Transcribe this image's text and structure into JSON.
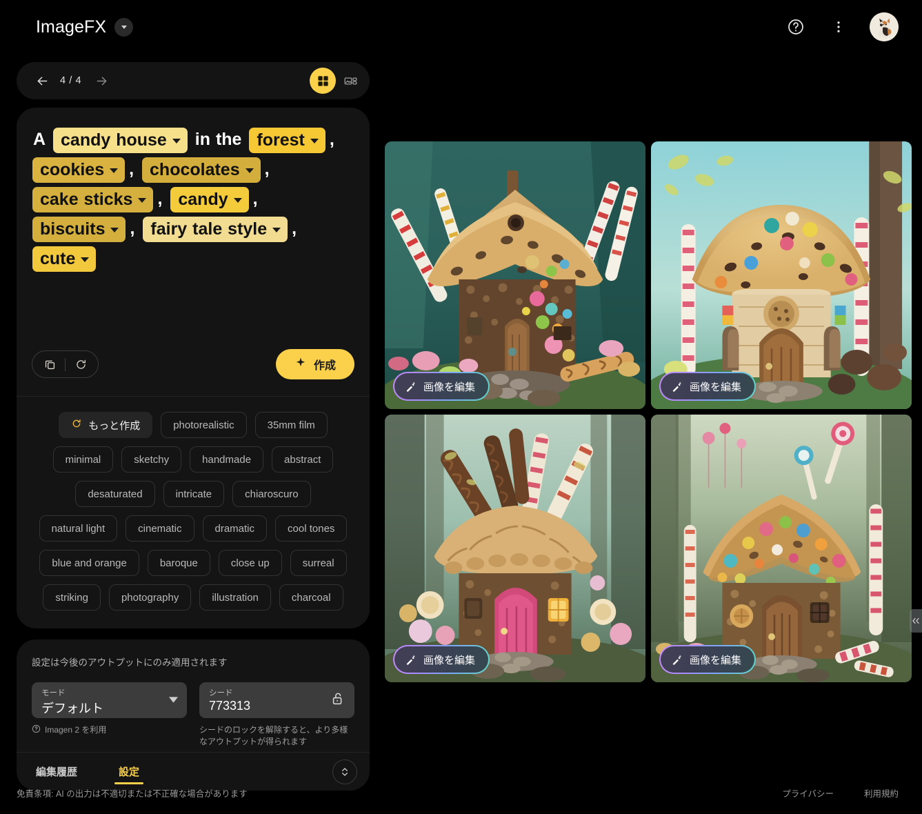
{
  "header": {
    "brand_title": "ImageFX",
    "brand_caret_icon": "chevron-down-icon",
    "help_icon": "help-circle-icon",
    "more_icon": "more-vertical-icon",
    "avatar_icon": "cat-avatar"
  },
  "nav": {
    "prev_icon": "arrow-left-icon",
    "next_icon": "arrow-right-icon",
    "page_indicator": "4 / 4",
    "grid_view_icon": "grid-view-icon",
    "detail_view_icon": "detail-view-icon"
  },
  "prompt": {
    "lead": "A",
    "connector": "in the",
    "chips": [
      {
        "label": "candy house",
        "shade": "#f6e08a"
      },
      {
        "label": "forest",
        "shade": "#f6c833"
      },
      {
        "label": "cookies",
        "shade": "#d9b23f"
      },
      {
        "label": "chocolates",
        "shade": "#d4ae3d"
      },
      {
        "label": "cake sticks",
        "shade": "#d6b03e"
      },
      {
        "label": "candy",
        "shade": "#f4cb3b"
      },
      {
        "label": "biscuits",
        "shade": "#d5af3e"
      },
      {
        "label": "fairy tale style",
        "shade": "#f2dc92"
      },
      {
        "label": "cute",
        "shade": "#f2c83c"
      }
    ],
    "comma": ",",
    "copy_icon": "copy-icon",
    "reset_icon": "refresh-icon",
    "create_label": "作成",
    "create_icon": "sparkle-icon"
  },
  "suggestions": {
    "rows": [
      [
        {
          "label": "もっと作成",
          "icon": "refresh-icon",
          "filled": true
        },
        {
          "label": "photorealistic",
          "filled": false
        },
        {
          "label": "35mm film",
          "filled": false
        }
      ],
      [
        {
          "label": "minimal",
          "filled": false
        },
        {
          "label": "sketchy",
          "filled": false
        },
        {
          "label": "handmade",
          "filled": false
        },
        {
          "label": "abstract",
          "filled": false
        }
      ],
      [
        {
          "label": "desaturated",
          "filled": false
        },
        {
          "label": "intricate",
          "filled": false
        },
        {
          "label": "chiaroscuro",
          "filled": false
        }
      ],
      [
        {
          "label": "natural light",
          "filled": false
        },
        {
          "label": "cinematic",
          "filled": false
        },
        {
          "label": "dramatic",
          "filled": false
        },
        {
          "label": "cool tones",
          "filled": false
        }
      ],
      [
        {
          "label": "blue and orange",
          "filled": false
        },
        {
          "label": "baroque",
          "filled": false
        },
        {
          "label": "close up",
          "filled": false
        },
        {
          "label": "surreal",
          "filled": false
        }
      ],
      [
        {
          "label": "striking",
          "filled": false
        },
        {
          "label": "photography",
          "filled": false
        },
        {
          "label": "illustration",
          "filled": false
        },
        {
          "label": "charcoal",
          "filled": false
        }
      ]
    ]
  },
  "settings": {
    "note": "設定は今後のアウトプットにのみ適用されます",
    "mode": {
      "label": "モード",
      "value": "デフォルト",
      "caret_icon": "chevron-down-icon",
      "hint": "Imagen 2 を利用",
      "hint_icon": "help-circle-icon"
    },
    "seed": {
      "label": "シード",
      "value": "773313",
      "lock_icon": "unlock-icon",
      "hint": "シードのロックを解除すると、より多様なアウトプットが得られます"
    }
  },
  "tabs": {
    "items": [
      {
        "label": "編集履歴",
        "active": false
      },
      {
        "label": "設定",
        "active": true
      }
    ],
    "expand_icon": "expand-vertical-icon"
  },
  "images": {
    "edit_label": "画像を編集",
    "edit_icon": "magic-wand-icon",
    "cells": [
      {
        "alt": "candy cookie-roof house in teal forest"
      },
      {
        "alt": "mushroom-shaped cookie house with candy dots"
      },
      {
        "alt": "wafer-roof cottage with pink door"
      },
      {
        "alt": "gingerbread house with lollipops in forest"
      }
    ]
  },
  "panel_collapse_icon": "collapse-panel-icon",
  "footer": {
    "disclaimer": "免責条項: AI の出力は不適切または不正確な場合があります",
    "links": [
      "プライバシー",
      "利用規約"
    ]
  }
}
